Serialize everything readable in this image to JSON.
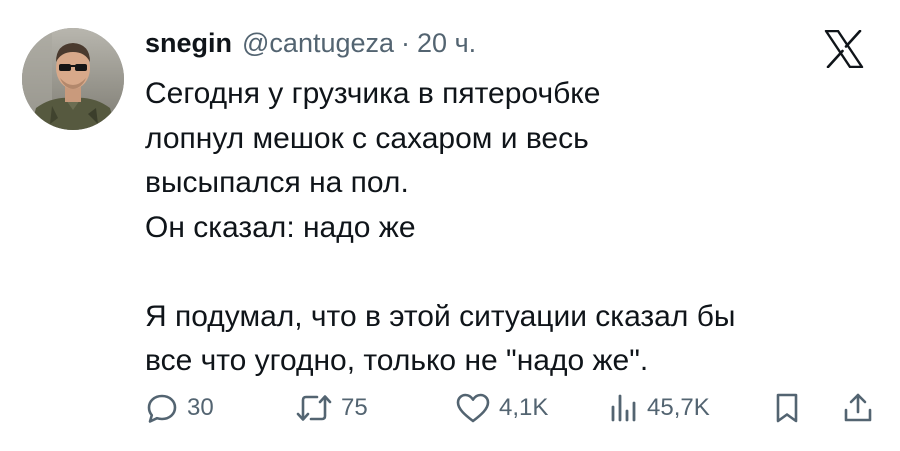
{
  "user": {
    "name": "snegin",
    "handle": "@cantugeza",
    "separator": "·",
    "time": "20 ч."
  },
  "tweet": {
    "lines": [
      "Сегодня у грузчика в пятерочбке",
      "лопнул мешок с сахаром и весь",
      "высыпался на пол.",
      "Он сказал: надо же",
      "",
      "Я подумал, что в этой ситуации сказал бы",
      "все что угодно, только не \"надо же\"."
    ]
  },
  "actions": {
    "replies": "30",
    "reposts": "75",
    "likes": "4,1K",
    "views": "45,7K"
  },
  "icons": {
    "logo": "x-logo-icon",
    "reply": "reply-icon",
    "repost": "repost-icon",
    "like": "heart-icon",
    "views": "views-icon",
    "bookmark": "bookmark-icon",
    "share": "share-icon"
  },
  "colors": {
    "text": "#0f1419",
    "secondary": "#536471",
    "background": "#ffffff"
  }
}
